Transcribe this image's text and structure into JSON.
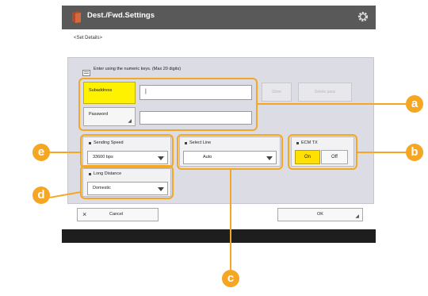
{
  "header": {
    "title": "Dest./Fwd.Settings",
    "breadcrumb": "<Set Details>"
  },
  "hint": "Enter using the numeric keys. (Max 20 digits)",
  "subaddress": {
    "label": "Subaddress",
    "value": "|"
  },
  "password": {
    "label": "Password",
    "value": ""
  },
  "ghost_buttons": {
    "store": "Store",
    "delete": "Delete pass"
  },
  "sending_speed": {
    "label": "Sending Speed",
    "value": "33600 bps"
  },
  "select_line": {
    "label": "Select Line",
    "value": "Auto"
  },
  "ecm_tx": {
    "label": "ECM TX",
    "on": "On",
    "off": "Off",
    "selected": "On"
  },
  "long_distance": {
    "label": "Long Distance",
    "value": "Domestic"
  },
  "footer": {
    "cancel_label": "Cancel",
    "ok_label": "OK"
  },
  "callouts": [
    "a",
    "b",
    "c",
    "d",
    "e"
  ],
  "colors": {
    "accent": "#f5a623",
    "selected_toggle": "#ffe000",
    "titlebar": "#595959"
  }
}
